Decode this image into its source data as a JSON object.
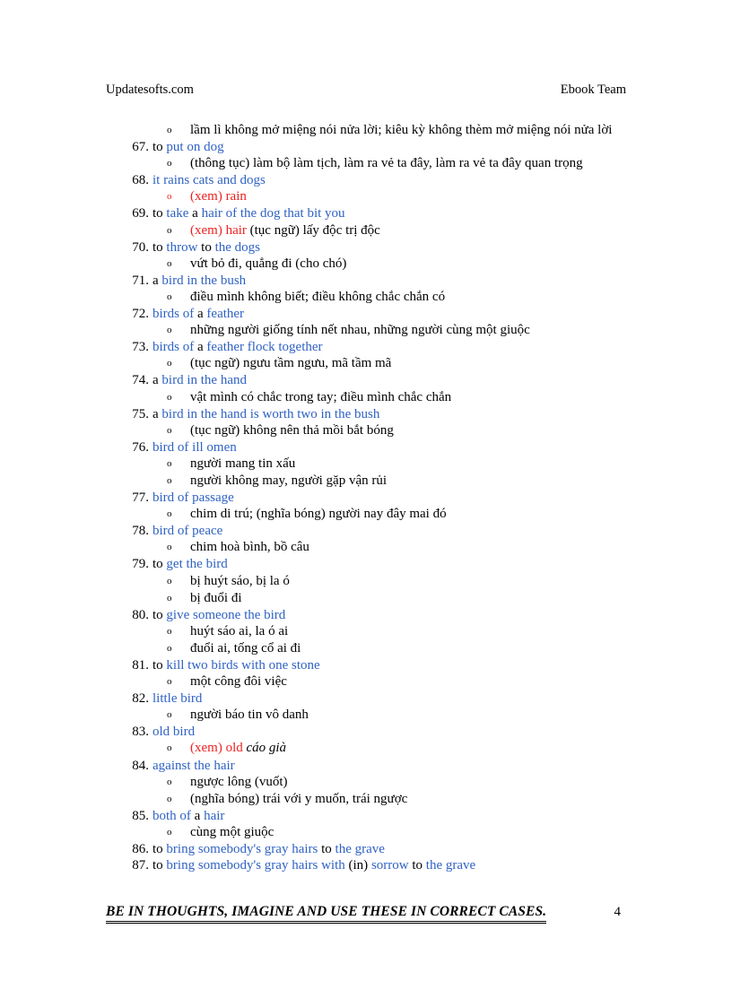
{
  "header": {
    "left": "Updatesofts.com",
    "right": "Ebook Team"
  },
  "colors": {
    "blue": "#2f62c4",
    "red": "#ee2020",
    "black": "#000000",
    "page_background": "#ffffff"
  },
  "bullet_glyph": "o",
  "entries": [
    {
      "number": "",
      "headline_segments": [],
      "bullets": [
        {
          "marker_color": "black",
          "segments": [
            {
              "text": "lầm lì không mở miệng nói nửa lời; kiêu kỳ không thèm mở miệng nói nửa lời",
              "color": "black",
              "italic": false
            }
          ]
        }
      ]
    },
    {
      "number": "67.",
      "headline_segments": [
        {
          "text": "to ",
          "color": "black",
          "italic": false
        },
        {
          "text": "put on dog",
          "color": "blue",
          "italic": false
        }
      ],
      "bullets": [
        {
          "marker_color": "black",
          "segments": [
            {
              "text": "(thông tục) làm bộ làm tịch, làm ra vẻ ta đây, làm ra vẻ ta đây quan trọng",
              "color": "black",
              "italic": false
            }
          ]
        }
      ]
    },
    {
      "number": "68.",
      "headline_segments": [
        {
          "text": "it rains cats and dogs",
          "color": "blue",
          "italic": false
        }
      ],
      "bullets": [
        {
          "marker_color": "red",
          "segments": [
            {
              "text": "(xem) rain",
              "color": "red",
              "italic": false
            }
          ]
        }
      ]
    },
    {
      "number": "69.",
      "headline_segments": [
        {
          "text": "to ",
          "color": "black",
          "italic": false
        },
        {
          "text": "take",
          "color": "blue",
          "italic": false
        },
        {
          "text": " a ",
          "color": "black",
          "italic": false
        },
        {
          "text": "hair of the dog that bit you",
          "color": "blue",
          "italic": false
        }
      ],
      "bullets": [
        {
          "marker_color": "black",
          "segments": [
            {
              "text": "(xem) hair",
              "color": "red",
              "italic": false
            },
            {
              "text": " (tục ngữ) lấy độc trị độc",
              "color": "black",
              "italic": false
            }
          ]
        }
      ]
    },
    {
      "number": "70.",
      "headline_segments": [
        {
          "text": "to ",
          "color": "black",
          "italic": false
        },
        {
          "text": "throw",
          "color": "blue",
          "italic": false
        },
        {
          "text": " to ",
          "color": "black",
          "italic": false
        },
        {
          "text": "the dogs",
          "color": "blue",
          "italic": false
        }
      ],
      "bullets": [
        {
          "marker_color": "black",
          "segments": [
            {
              "text": "vứt bỏ đi, quẳng đi (cho chó)",
              "color": "black",
              "italic": false
            }
          ]
        }
      ]
    },
    {
      "number": "71.",
      "headline_segments": [
        {
          "text": "a ",
          "color": "black",
          "italic": false
        },
        {
          "text": "bird in the bush",
          "color": "blue",
          "italic": false
        }
      ],
      "bullets": [
        {
          "marker_color": "black",
          "segments": [
            {
              "text": "điều mình không biết; điều không chắc chắn có",
              "color": "black",
              "italic": false
            }
          ]
        }
      ]
    },
    {
      "number": "72.",
      "headline_segments": [
        {
          "text": "birds of",
          "color": "blue",
          "italic": false
        },
        {
          "text": " a ",
          "color": "black",
          "italic": false
        },
        {
          "text": "feather",
          "color": "blue",
          "italic": false
        }
      ],
      "bullets": [
        {
          "marker_color": "black",
          "segments": [
            {
              "text": "những người giống tính nết nhau, những người cùng một giuộc",
              "color": "black",
              "italic": false
            }
          ]
        }
      ]
    },
    {
      "number": "73.",
      "headline_segments": [
        {
          "text": "birds of",
          "color": "blue",
          "italic": false
        },
        {
          "text": " a ",
          "color": "black",
          "italic": false
        },
        {
          "text": "feather flock together",
          "color": "blue",
          "italic": false
        }
      ],
      "bullets": [
        {
          "marker_color": "black",
          "segments": [
            {
              "text": "(tục ngữ) ngưu tầm ngưu, mã tầm mã",
              "color": "black",
              "italic": false
            }
          ]
        }
      ]
    },
    {
      "number": "74.",
      "headline_segments": [
        {
          "text": "a ",
          "color": "black",
          "italic": false
        },
        {
          "text": "bird in the hand",
          "color": "blue",
          "italic": false
        }
      ],
      "bullets": [
        {
          "marker_color": "black",
          "segments": [
            {
              "text": "vật mình có chắc trong tay; điều mình chắc chắn",
              "color": "black",
              "italic": false
            }
          ]
        }
      ]
    },
    {
      "number": "75.",
      "headline_segments": [
        {
          "text": "a ",
          "color": "black",
          "italic": false
        },
        {
          "text": "bird in the hand is worth two in the bush",
          "color": "blue",
          "italic": false
        }
      ],
      "bullets": [
        {
          "marker_color": "black",
          "segments": [
            {
              "text": "(tục ngữ) không nên thả mồi bắt bóng",
              "color": "black",
              "italic": false
            }
          ]
        }
      ]
    },
    {
      "number": "76.",
      "headline_segments": [
        {
          "text": "bird of ill omen",
          "color": "blue",
          "italic": false
        }
      ],
      "bullets": [
        {
          "marker_color": "black",
          "segments": [
            {
              "text": "người mang tin xấu",
              "color": "black",
              "italic": false
            }
          ]
        },
        {
          "marker_color": "black",
          "segments": [
            {
              "text": "người không may, người gặp vận rủi",
              "color": "black",
              "italic": false
            }
          ]
        }
      ]
    },
    {
      "number": "77.",
      "headline_segments": [
        {
          "text": "bird of passage",
          "color": "blue",
          "italic": false
        }
      ],
      "bullets": [
        {
          "marker_color": "black",
          "segments": [
            {
              "text": "chim di trú; (nghĩa bóng) người nay đây mai đó",
              "color": "black",
              "italic": false
            }
          ]
        }
      ]
    },
    {
      "number": "78.",
      "headline_segments": [
        {
          "text": "bird of peace",
          "color": "blue",
          "italic": false
        }
      ],
      "bullets": [
        {
          "marker_color": "black",
          "segments": [
            {
              "text": "chim hoà bình, bồ câu",
              "color": "black",
              "italic": false
            }
          ]
        }
      ]
    },
    {
      "number": "79.",
      "headline_segments": [
        {
          "text": "to ",
          "color": "black",
          "italic": false
        },
        {
          "text": "get the bird",
          "color": "blue",
          "italic": false
        }
      ],
      "bullets": [
        {
          "marker_color": "black",
          "segments": [
            {
              "text": "bị huýt sáo, bị la ó",
              "color": "black",
              "italic": false
            }
          ]
        },
        {
          "marker_color": "black",
          "segments": [
            {
              "text": "bị đuổi đi",
              "color": "black",
              "italic": false
            }
          ]
        }
      ]
    },
    {
      "number": "80.",
      "headline_segments": [
        {
          "text": "to ",
          "color": "black",
          "italic": false
        },
        {
          "text": "give someone the bird",
          "color": "blue",
          "italic": false
        }
      ],
      "bullets": [
        {
          "marker_color": "black",
          "segments": [
            {
              "text": "huýt sáo ai, la ó ai",
              "color": "black",
              "italic": false
            }
          ]
        },
        {
          "marker_color": "black",
          "segments": [
            {
              "text": "đuổi ai, tống cổ ai đi",
              "color": "black",
              "italic": false
            }
          ]
        }
      ]
    },
    {
      "number": "81.",
      "headline_segments": [
        {
          "text": "to ",
          "color": "black",
          "italic": false
        },
        {
          "text": "kill two birds with one stone",
          "color": "blue",
          "italic": false
        }
      ],
      "bullets": [
        {
          "marker_color": "black",
          "segments": [
            {
              "text": "một công đôi việc",
              "color": "black",
              "italic": false
            }
          ]
        }
      ]
    },
    {
      "number": "82.",
      "headline_segments": [
        {
          "text": "little bird",
          "color": "blue",
          "italic": false
        }
      ],
      "bullets": [
        {
          "marker_color": "black",
          "segments": [
            {
              "text": "người báo tin vô danh",
              "color": "black",
              "italic": false
            }
          ]
        }
      ]
    },
    {
      "number": "83.",
      "headline_segments": [
        {
          "text": "old bird",
          "color": "blue",
          "italic": false
        }
      ],
      "bullets": [
        {
          "marker_color": "black",
          "segments": [
            {
              "text": "(xem) old",
              "color": "red",
              "italic": false
            },
            {
              "text": " cáo già",
              "color": "black",
              "italic": true
            }
          ]
        }
      ]
    },
    {
      "number": "84.",
      "headline_segments": [
        {
          "text": "against the hair",
          "color": "blue",
          "italic": false
        }
      ],
      "bullets": [
        {
          "marker_color": "black",
          "segments": [
            {
              "text": "ngược lông (vuốt)",
              "color": "black",
              "italic": false
            }
          ]
        },
        {
          "marker_color": "black",
          "segments": [
            {
              "text": "(nghĩa bóng) trái với y muốn, trái ngược",
              "color": "black",
              "italic": false
            }
          ]
        }
      ]
    },
    {
      "number": "85.",
      "headline_segments": [
        {
          "text": "both of",
          "color": "blue",
          "italic": false
        },
        {
          "text": " a ",
          "color": "black",
          "italic": false
        },
        {
          "text": "hair",
          "color": "blue",
          "italic": false
        }
      ],
      "bullets": [
        {
          "marker_color": "black",
          "segments": [
            {
              "text": "cùng một giuộc",
              "color": "black",
              "italic": false
            }
          ]
        }
      ]
    },
    {
      "number": "86.",
      "headline_segments": [
        {
          "text": "to ",
          "color": "black",
          "italic": false
        },
        {
          "text": "bring somebody's gray hairs",
          "color": "blue",
          "italic": false
        },
        {
          "text": " to ",
          "color": "black",
          "italic": false
        },
        {
          "text": "the grave",
          "color": "blue",
          "italic": false
        }
      ],
      "bullets": []
    },
    {
      "number": "87.",
      "headline_segments": [
        {
          "text": "to ",
          "color": "black",
          "italic": false
        },
        {
          "text": "bring somebody's gray hairs with",
          "color": "blue",
          "italic": false
        },
        {
          "text": " (in) ",
          "color": "black",
          "italic": false
        },
        {
          "text": "sorrow",
          "color": "blue",
          "italic": false
        },
        {
          "text": " to ",
          "color": "black",
          "italic": false
        },
        {
          "text": "the grave",
          "color": "blue",
          "italic": false
        }
      ],
      "bullets": []
    }
  ],
  "footer": {
    "text": "BE IN THOUGHTS, IMAGINE AND USE THESE IN CORRECT CASES.",
    "page_number": "4"
  }
}
